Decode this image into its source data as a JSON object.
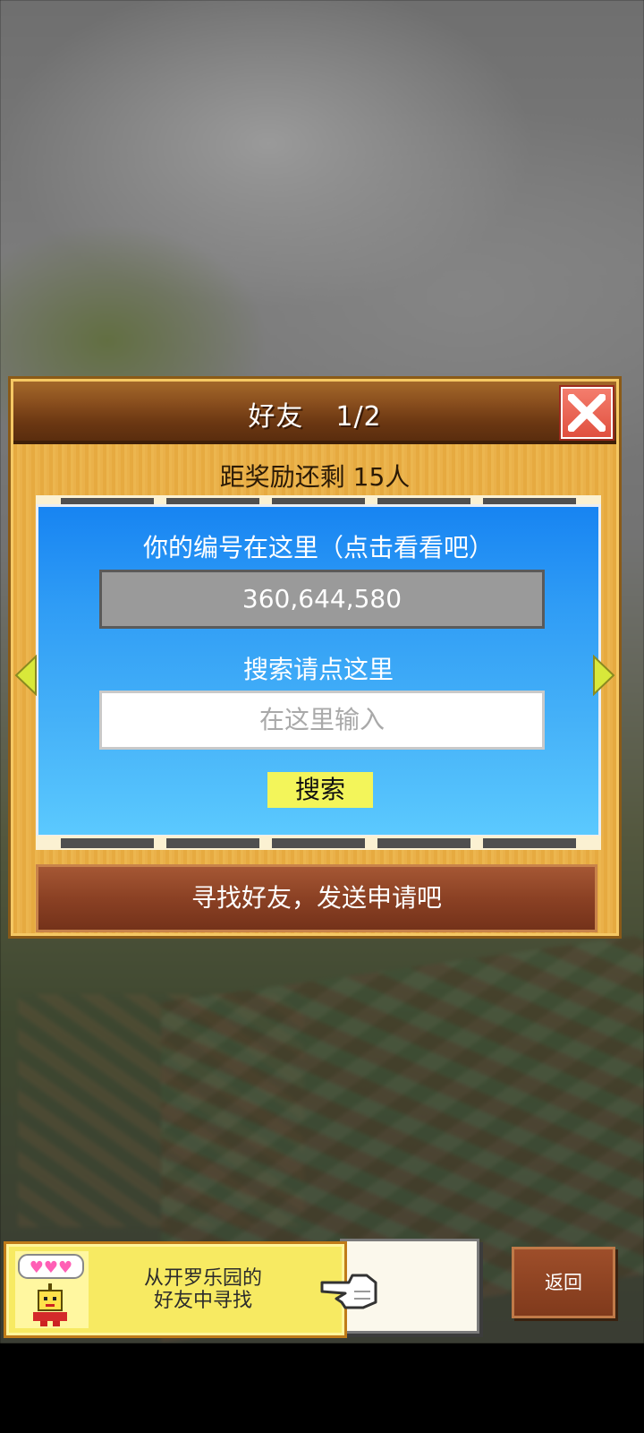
{
  "dialog": {
    "title": "好友",
    "page": "1/2",
    "reward_text": "距奖励还剩 15人",
    "id_label": "你的编号在这里（点击看看吧）",
    "id_value": "360,644,580",
    "search_label": "搜索请点这里",
    "search_placeholder": "在这里输入",
    "search_button": "搜索",
    "find_button": "寻找好友，发送申请吧"
  },
  "bottom": {
    "friend_card_line1": "从开罗乐园的",
    "friend_card_line2": "好友中寻找",
    "back_button": "返回"
  },
  "colors": {
    "panel_blue": "#1784f2",
    "header_brown": "#6b3712",
    "search_button_yellow": "#f3f55a",
    "close_red": "#e0503f"
  },
  "icons": [
    "close-icon",
    "arrow-left-icon",
    "arrow-right-icon",
    "pointing-hand-icon",
    "character-avatar-icon",
    "hearts-bubble-icon"
  ]
}
